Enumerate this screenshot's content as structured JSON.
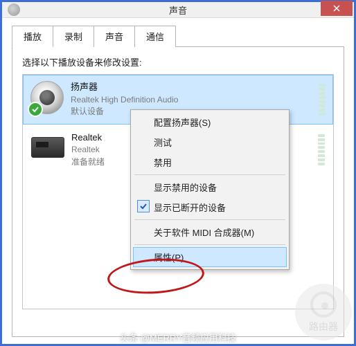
{
  "window": {
    "title": "声音"
  },
  "tabs": [
    {
      "label": "播放",
      "active": true
    },
    {
      "label": "录制",
      "active": false
    },
    {
      "label": "声音",
      "active": false
    },
    {
      "label": "通信",
      "active": false
    }
  ],
  "instruction": "选择以下播放设备来修改设置:",
  "devices": [
    {
      "name": "扬声器",
      "subtitle": "Realtek High Definition Audio",
      "status": "默认设备",
      "selected": true,
      "default_badge": true
    },
    {
      "name": "Realtek",
      "subtitle": "Realtek",
      "status": "准备就绪",
      "selected": false,
      "default_badge": false
    }
  ],
  "context_menu": {
    "items": [
      {
        "label": "配置扬声器(S)",
        "enabled": true
      },
      {
        "label": "测试",
        "enabled": true
      },
      {
        "label": "禁用",
        "enabled": true
      }
    ],
    "group2": [
      {
        "label": "显示禁用的设备",
        "checked": false
      },
      {
        "label": "显示已断开的设备",
        "checked": true
      }
    ],
    "group3": [
      {
        "label": "关于软件 MIDI 合成器(M)",
        "enabled": true
      }
    ],
    "highlight": {
      "label": "属性(P)"
    }
  },
  "watermarks": {
    "router_label": "路由器",
    "footer": "头条 @MERRY音频应用科技"
  }
}
